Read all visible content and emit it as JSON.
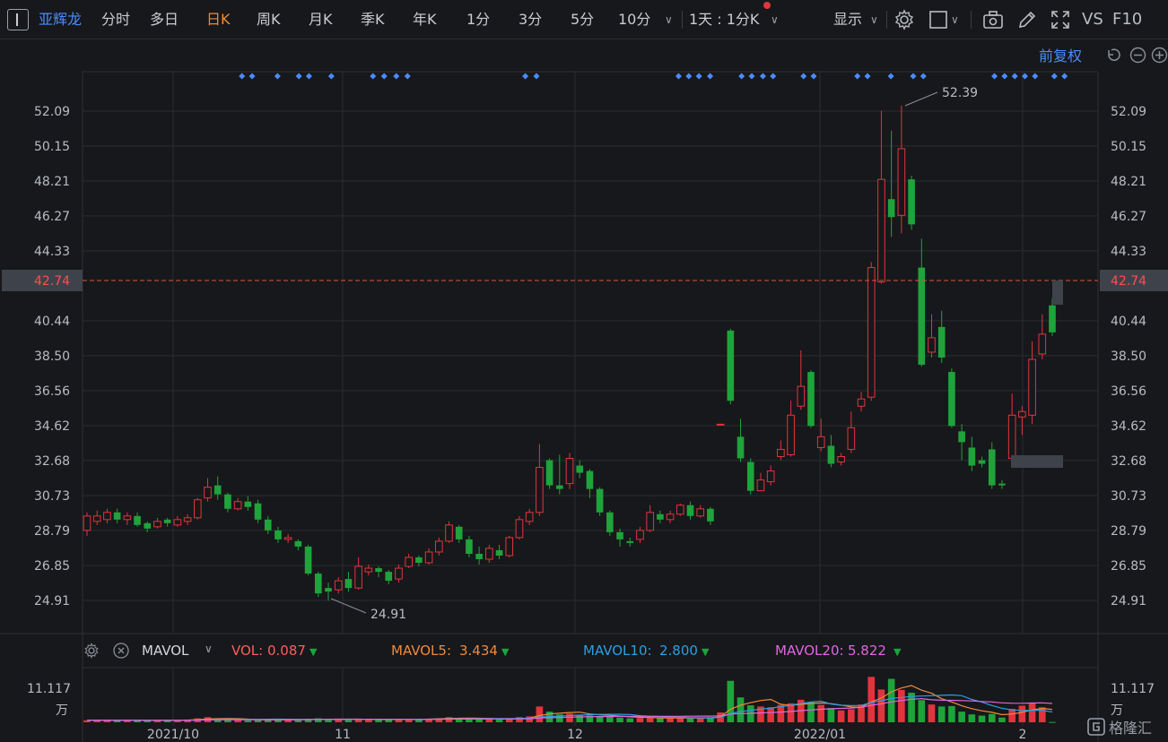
{
  "toolbar": {
    "stock_name": "亚辉龙",
    "tabs": [
      "分时",
      "多日",
      "日K",
      "周K",
      "月K",
      "季K",
      "年K",
      "1分",
      "3分",
      "5分",
      "10分"
    ],
    "active_tab": "日K",
    "period_select": "1天 : 1分K",
    "display_label": "显示",
    "vs_label": "VS",
    "f10_label": "F10"
  },
  "fuquan_label": "前复权",
  "price_axis": {
    "ticks": [
      "52.09",
      "50.15",
      "48.21",
      "46.27",
      "44.33",
      "42.74",
      "40.44",
      "38.50",
      "36.56",
      "34.62",
      "32.68",
      "30.73",
      "28.79",
      "26.85",
      "24.91"
    ],
    "current_price": "42.74",
    "high_label": "52.39",
    "low_label": "24.91"
  },
  "volume": {
    "indicator": "MAVOL",
    "vol_label": "VOL:",
    "vol_value": "0.087",
    "ma5_label": "MAVOL5:",
    "ma5_value": "3.434",
    "ma10_label": "MAVOL10:",
    "ma10_value": "2.800",
    "ma20_label": "MAVOL20:",
    "ma20_value": "5.822",
    "axis_value": "11.117",
    "axis_unit": "万"
  },
  "date_axis": [
    "2021/10",
    "11",
    "12",
    "2022/01",
    "2"
  ],
  "watermark": "格隆汇",
  "colors": {
    "up": "#e2343d",
    "down": "#1fa33b",
    "accent_orange": "#f08a3c",
    "accent_blue": "#4a8cff",
    "ma5": "#f08a3c",
    "ma10": "#2b9fe6",
    "ma20": "#e066e0"
  },
  "chart_data": {
    "type": "candlestick",
    "ylim": [
      24.0,
      53.5
    ],
    "candles": [
      [
        28.8,
        29.6,
        28.5,
        29.8
      ],
      [
        29.3,
        29.6,
        29.1,
        29.9
      ],
      [
        29.4,
        29.8,
        29.2,
        30.0
      ],
      [
        29.8,
        29.4,
        29.2,
        30.0
      ],
      [
        29.4,
        29.6,
        29.1,
        29.8
      ],
      [
        29.6,
        29.1,
        29.0,
        29.8
      ],
      [
        29.2,
        28.9,
        28.7,
        29.3
      ],
      [
        29.0,
        29.3,
        28.9,
        29.5
      ],
      [
        29.4,
        29.2,
        29.0,
        29.5
      ],
      [
        29.1,
        29.4,
        29.0,
        29.6
      ],
      [
        29.3,
        29.5,
        29.1,
        29.7
      ],
      [
        29.5,
        30.5,
        29.4,
        30.6
      ],
      [
        30.6,
        31.2,
        30.4,
        31.7
      ],
      [
        31.3,
        30.8,
        30.5,
        31.8
      ],
      [
        30.8,
        30.0,
        29.8,
        30.9
      ],
      [
        30.0,
        30.4,
        29.9,
        30.6
      ],
      [
        30.4,
        30.1,
        29.9,
        30.7
      ],
      [
        30.3,
        29.4,
        29.2,
        30.5
      ],
      [
        29.4,
        28.8,
        28.6,
        29.6
      ],
      [
        28.8,
        28.3,
        28.1,
        29.0
      ],
      [
        28.3,
        28.4,
        28.1,
        28.6
      ],
      [
        28.2,
        27.9,
        27.7,
        28.3
      ],
      [
        27.9,
        26.4,
        26.3,
        28.0
      ],
      [
        26.4,
        25.3,
        25.1,
        26.5
      ],
      [
        25.6,
        25.4,
        24.9,
        25.9
      ],
      [
        25.5,
        26.0,
        25.3,
        26.2
      ],
      [
        26.1,
        25.6,
        25.4,
        26.5
      ],
      [
        25.6,
        26.8,
        25.5,
        27.3
      ],
      [
        26.5,
        26.7,
        26.3,
        26.9
      ],
      [
        26.7,
        26.5,
        26.2,
        26.8
      ],
      [
        26.5,
        26.0,
        25.8,
        26.6
      ],
      [
        26.1,
        26.7,
        25.9,
        26.9
      ],
      [
        26.8,
        27.3,
        26.7,
        27.5
      ],
      [
        27.3,
        27.0,
        26.8,
        27.4
      ],
      [
        27.0,
        27.6,
        26.9,
        27.8
      ],
      [
        27.6,
        28.2,
        27.4,
        28.4
      ],
      [
        28.2,
        29.1,
        28.1,
        29.3
      ],
      [
        29.0,
        28.3,
        28.1,
        29.1
      ],
      [
        28.3,
        27.5,
        27.3,
        28.5
      ],
      [
        27.5,
        27.2,
        26.9,
        27.9
      ],
      [
        27.2,
        27.8,
        27.0,
        28.0
      ],
      [
        27.7,
        27.4,
        27.2,
        28.0
      ],
      [
        27.4,
        28.4,
        27.3,
        28.5
      ],
      [
        28.4,
        29.4,
        28.3,
        29.6
      ],
      [
        29.3,
        29.8,
        29.1,
        30.0
      ],
      [
        29.8,
        32.3,
        29.6,
        33.6
      ],
      [
        32.7,
        31.3,
        31.1,
        32.8
      ],
      [
        31.3,
        31.1,
        30.8,
        33.0
      ],
      [
        31.4,
        32.8,
        31.1,
        33.1
      ],
      [
        32.4,
        32.0,
        31.7,
        32.7
      ],
      [
        32.1,
        31.1,
        30.6,
        32.2
      ],
      [
        31.1,
        29.8,
        29.6,
        31.2
      ],
      [
        29.8,
        28.7,
        28.5,
        29.9
      ],
      [
        28.7,
        28.3,
        27.9,
        28.9
      ],
      [
        28.2,
        28.1,
        27.9,
        28.4
      ],
      [
        28.3,
        28.8,
        28.1,
        29.0
      ],
      [
        28.8,
        29.8,
        28.7,
        30.2
      ],
      [
        29.7,
        29.4,
        29.2,
        29.9
      ],
      [
        29.4,
        29.7,
        29.2,
        29.9
      ],
      [
        29.7,
        30.2,
        29.6,
        30.3
      ],
      [
        30.2,
        29.6,
        29.4,
        30.4
      ],
      [
        29.6,
        30.0,
        29.5,
        30.2
      ],
      [
        30.0,
        29.3,
        29.1,
        30.1
      ],
      [
        34.7,
        34.7,
        34.7,
        34.7
      ],
      [
        39.9,
        36.0,
        35.8,
        40.0
      ],
      [
        34.0,
        32.8,
        32.6,
        35.0
      ],
      [
        32.6,
        31.0,
        30.8,
        32.8
      ],
      [
        31.0,
        31.6,
        31.0,
        32.0
      ],
      [
        31.5,
        32.1,
        31.3,
        32.4
      ],
      [
        32.9,
        33.3,
        32.7,
        33.8
      ],
      [
        33.0,
        35.2,
        32.9,
        36.0
      ],
      [
        35.7,
        36.8,
        35.5,
        38.8
      ],
      [
        37.6,
        34.6,
        34.5,
        37.7
      ],
      [
        33.4,
        34.0,
        33.2,
        35.0
      ],
      [
        33.5,
        32.5,
        32.3,
        34.1
      ],
      [
        32.6,
        32.9,
        32.4,
        33.1
      ],
      [
        33.3,
        34.5,
        33.1,
        35.4
      ],
      [
        35.7,
        36.1,
        35.4,
        36.5
      ],
      [
        36.2,
        43.4,
        36.0,
        43.7
      ],
      [
        42.6,
        48.3,
        42.5,
        52.1
      ],
      [
        47.2,
        46.2,
        45.1,
        51.0
      ],
      [
        46.3,
        50.0,
        45.3,
        52.4
      ],
      [
        48.3,
        45.8,
        45.5,
        48.5
      ],
      [
        43.4,
        38.0,
        37.9,
        45.0
      ],
      [
        38.7,
        39.5,
        38.4,
        40.8
      ],
      [
        40.1,
        38.4,
        38.1,
        41.0
      ],
      [
        37.6,
        34.6,
        34.5,
        37.8
      ],
      [
        34.3,
        33.7,
        32.7,
        34.7
      ],
      [
        33.4,
        32.4,
        32.1,
        34.0
      ],
      [
        32.7,
        32.5,
        32.3,
        32.9
      ],
      [
        33.3,
        31.3,
        31.1,
        33.7
      ],
      [
        31.4,
        31.3,
        31.1,
        31.6
      ],
      [
        32.8,
        35.2,
        32.6,
        36.4
      ],
      [
        35.1,
        35.4,
        34.1,
        35.7
      ],
      [
        35.2,
        38.3,
        34.7,
        39.3
      ],
      [
        38.6,
        39.7,
        38.3,
        40.8
      ],
      [
        41.3,
        39.8,
        39.6,
        41.7
      ]
    ],
    "volumes": [
      0.5,
      0.6,
      0.5,
      0.5,
      0.5,
      0.5,
      0.4,
      0.5,
      0.5,
      0.6,
      0.7,
      1.0,
      1.3,
      0.9,
      0.7,
      0.6,
      0.5,
      0.7,
      0.8,
      0.7,
      0.6,
      0.6,
      0.9,
      1.0,
      0.8,
      0.7,
      0.6,
      0.9,
      0.7,
      0.6,
      0.6,
      0.8,
      0.9,
      0.8,
      0.9,
      1.0,
      1.3,
      1.1,
      0.9,
      0.8,
      0.8,
      0.7,
      1.0,
      1.3,
      1.5,
      4.0,
      2.7,
      2.0,
      2.2,
      1.9,
      1.7,
      1.6,
      1.4,
      1.2,
      1.0,
      1.1,
      1.3,
      1.1,
      1.0,
      1.1,
      1.0,
      1.1,
      1.3,
      2.5,
      10.5,
      6.3,
      4.3,
      4.0,
      3.8,
      4.4,
      4.8,
      5.7,
      5.1,
      4.4,
      3.6,
      3.0,
      3.3,
      4.5,
      11.5,
      8.3,
      11.0,
      8.2,
      7.5,
      5.6,
      4.5,
      4.0,
      4.1,
      2.7,
      2.0,
      1.7,
      2.1,
      1.2,
      3.4,
      4.2,
      4.9,
      3.8,
      0.087
    ],
    "markers_x_fraction": [
      0.157,
      0.167,
      0.192,
      0.213,
      0.223,
      0.245,
      0.286,
      0.297,
      0.309,
      0.32,
      0.436,
      0.447,
      0.587,
      0.597,
      0.607,
      0.618,
      0.649,
      0.659,
      0.67,
      0.68,
      0.71,
      0.72,
      0.763,
      0.773,
      0.796,
      0.818,
      0.828,
      0.898,
      0.908,
      0.918,
      0.928,
      0.938,
      0.957,
      0.967
    ]
  }
}
